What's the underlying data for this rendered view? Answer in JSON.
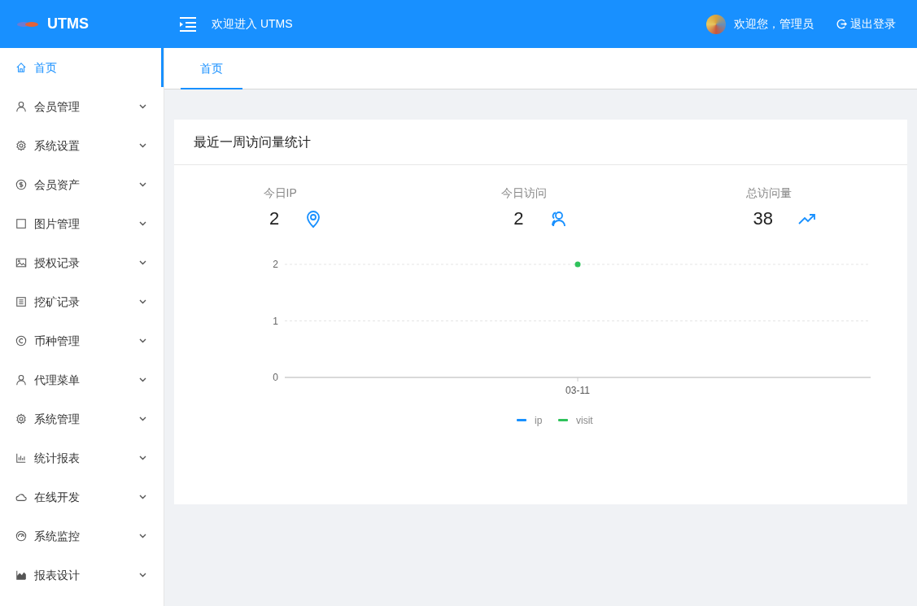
{
  "header": {
    "brand": "UTMS",
    "welcome": "欢迎进入 UTMS",
    "user_greeting": "欢迎您，管理员",
    "logout": "退出登录"
  },
  "sidebar": {
    "items": [
      {
        "label": "首页",
        "selected": true,
        "submenu": false
      },
      {
        "label": "会员管理",
        "selected": false,
        "submenu": true
      },
      {
        "label": "系统设置",
        "selected": false,
        "submenu": true
      },
      {
        "label": "会员资产",
        "selected": false,
        "submenu": true
      },
      {
        "label": "图片管理",
        "selected": false,
        "submenu": true
      },
      {
        "label": "授权记录",
        "selected": false,
        "submenu": true
      },
      {
        "label": "挖矿记录",
        "selected": false,
        "submenu": true
      },
      {
        "label": "币种管理",
        "selected": false,
        "submenu": true
      },
      {
        "label": "代理菜单",
        "selected": false,
        "submenu": true
      },
      {
        "label": "系统管理",
        "selected": false,
        "submenu": true
      },
      {
        "label": "统计报表",
        "selected": false,
        "submenu": true
      },
      {
        "label": "在线开发",
        "selected": false,
        "submenu": true
      },
      {
        "label": "系统监控",
        "selected": false,
        "submenu": true
      },
      {
        "label": "报表设计",
        "selected": false,
        "submenu": true
      }
    ]
  },
  "tabs": [
    {
      "label": "首页",
      "selected": true
    }
  ],
  "card": {
    "title": "最近一周访问量统计",
    "stats": [
      {
        "label": "今日IP",
        "value": "2"
      },
      {
        "label": "今日访问",
        "value": "2"
      },
      {
        "label": "总访问量",
        "value": "38"
      }
    ],
    "chart_data": {
      "type": "line",
      "categories": [
        "03-11"
      ],
      "yticks": [
        0,
        1,
        2
      ],
      "ylim": [
        0,
        2
      ],
      "legend": "bottom",
      "series": [
        {
          "name": "ip",
          "color": "#1890ff",
          "values": [
            null
          ],
          "marker": "circle"
        },
        {
          "name": "visit",
          "color": "#2fc25b",
          "values": [
            2
          ],
          "marker": "circle"
        }
      ]
    }
  }
}
